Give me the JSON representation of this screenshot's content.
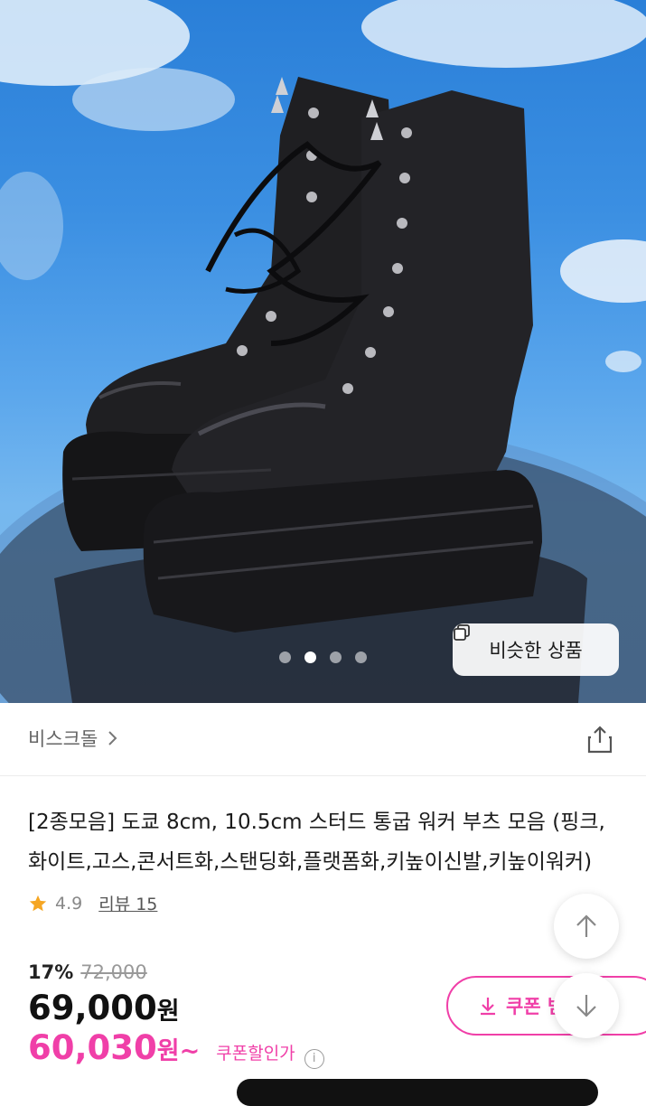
{
  "hero": {
    "carousel": {
      "count": 4,
      "active_index": 1
    },
    "similar_button_label": "비슷한 상품"
  },
  "shop": {
    "name": "비스크돌"
  },
  "product": {
    "title": "[2종모음] 도쿄 8cm, 10.5cm 스터드 통굽 워커 부츠 모음 (핑크,화이트,고스,콘서트화,스탠딩화,플랫폼화,키높이신발,키높이워커)",
    "rating": "4.9",
    "review_label": "리뷰 15"
  },
  "pricing": {
    "discount_rate": "17%",
    "original_price": "72,000",
    "price": "69,000",
    "price_unit": "원",
    "coupon_price": "60,030",
    "coupon_price_unit": "원~",
    "coupon_price_label": "쿠폰할인가",
    "coupon_button_label": "쿠폰 받기"
  },
  "colors": {
    "accent": "#f03fa8",
    "star": "#f5a623"
  }
}
